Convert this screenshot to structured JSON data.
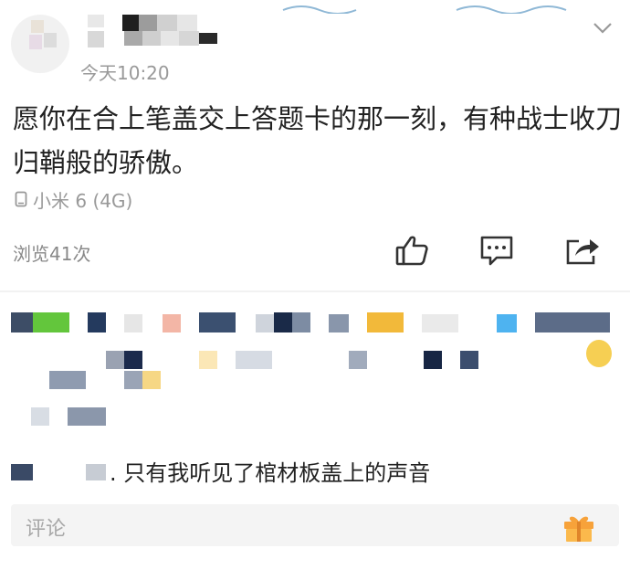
{
  "post": {
    "time": "今天10:20",
    "text": "愿你在合上笔盖交上答题卡的那一刻，有种战士收刀归鞘般的骄傲。",
    "device": "小米 6 (4G)",
    "views": "浏览41次"
  },
  "actions": {
    "like_icon": "thumbs-up-icon",
    "comment_icon": "comment-icon",
    "share_icon": "share-icon"
  },
  "comment": {
    "text": ". 只有我听见了棺材板盖上的声音"
  },
  "input": {
    "placeholder": "评论"
  },
  "colors": {
    "time_gray": "#999999",
    "text_dark": "#222222",
    "icon_dark": "#333333",
    "banner_blue": "#4a7fa8"
  }
}
